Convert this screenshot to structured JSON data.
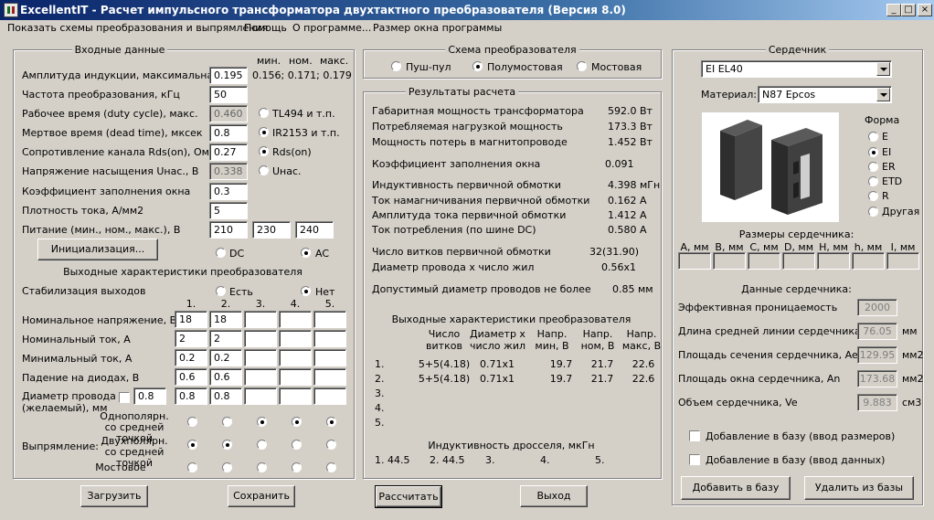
{
  "window": {
    "title": "ExcellentIT - Расчет импульсного трансформатора двухтактного преобразователя (Версия 8.0)",
    "min": "_",
    "max": "□",
    "close": "×"
  },
  "menu": [
    "Показать схемы преобразования и выпрямления",
    "Помощь",
    "О программе...",
    "Размер окна программы"
  ],
  "input": {
    "group_title": "Входные данные",
    "hint_headers": [
      "мин.",
      "ном.",
      "макс."
    ],
    "induction": {
      "label": "Амплитуда индукции, максимальная, Т",
      "value": "0.195",
      "hint": "0.156; 0.171; 0.179"
    },
    "frequency": {
      "label": "Частота преобразования, кГц",
      "value": "50"
    },
    "duty": {
      "label": "Рабочее время (duty cycle), макс.",
      "value": "0.460",
      "option": "TL494 и т.п."
    },
    "dead": {
      "label": "Мертвое время (dead time), мксек",
      "value": "0.8",
      "option": "IR2153 и т.п."
    },
    "rds": {
      "label": "Сопротивление канала Rds(on), Ом",
      "value": "0.27",
      "option": "Rds(on)"
    },
    "usat": {
      "label": "Напряжение насыщения Uнас., В",
      "value": "0.338",
      "option": "Uнас."
    },
    "fill": {
      "label": "Коэффициент заполнения окна",
      "value": "0.3"
    },
    "density": {
      "label": "Плотность тока, А/мм2",
      "value": "5"
    },
    "supply": {
      "label": "Питание (мин., ном., макс.), В",
      "values": [
        "210",
        "230",
        "240"
      ]
    },
    "init_button": "Инициализация...",
    "dc": "DC",
    "ac": "AC"
  },
  "output": {
    "title": "Выходные характеристики преобразователя",
    "stab_label": "Стабилизация выходов",
    "stab_yes": "Есть",
    "stab_no": "Нет",
    "cols": [
      "1.",
      "2.",
      "3.",
      "4.",
      "5."
    ],
    "voltage": {
      "label": "Номинальное напряжение, В",
      "values": [
        "18",
        "18",
        "",
        "",
        ""
      ]
    },
    "current": {
      "label": "Номинальный ток, А",
      "values": [
        "2",
        "2",
        "",
        "",
        ""
      ]
    },
    "min_current": {
      "label": "Минимальный ток, А",
      "values": [
        "0.2",
        "0.2",
        "",
        "",
        ""
      ]
    },
    "diode_drop": {
      "label": "Падение на диодах, В",
      "values": [
        "0.6",
        "0.6",
        "",
        "",
        ""
      ]
    },
    "wire": {
      "label1": "Диаметр провода",
      "label2": "(желаемый), мм",
      "desired": "0.8",
      "values": [
        "0.8",
        "0.8",
        "",
        "",
        ""
      ]
    },
    "rect_label": "Выпрямление:",
    "rect_opts": [
      "Однополярн. со средней точкой",
      "Двухполярн. со средней точкой",
      "Мостовое"
    ]
  },
  "scheme": {
    "title": "Схема преобразователя",
    "options": [
      "Пуш-пул",
      "Полумостовая",
      "Мостовая"
    ]
  },
  "results": {
    "title": "Результаты расчета",
    "rows": [
      {
        "label": "Габаритная мощность трансформатора",
        "value": "592.0 Вт"
      },
      {
        "label": "Потребляемая нагрузкой мощность",
        "value": "173.3 Вт"
      },
      {
        "label": "Мощность потерь в магнитопроводе",
        "value": "1.452 Вт"
      },
      {
        "label": "Коэффициент заполнения окна",
        "value": "0.091"
      },
      {
        "label": "Индуктивность первичной обмотки",
        "value": "4.398 мГн"
      },
      {
        "label": "Ток намагничивания первичной обмотки",
        "value": "0.162 А"
      },
      {
        "label": "Амплитуда тока первичной обмотки",
        "value": "1.412 А"
      },
      {
        "label": "Ток потребления (по шине DC)",
        "value": "0.580 А"
      },
      {
        "label": "Число витков первичной обмотки",
        "value": "32(31.90)"
      },
      {
        "label": "Диаметр провода х число жил",
        "value": "0.56х1"
      },
      {
        "label": "Допустимый диаметр проводов не более",
        "value": "0.85 мм"
      }
    ],
    "out_title": "Выходные характеристики преобразователя",
    "out_headers": [
      [
        "Число",
        "витков"
      ],
      [
        "Диаметр х",
        "число жил"
      ],
      [
        "Напр.",
        "мин, В"
      ],
      [
        "Напр.",
        "ном, В"
      ],
      [
        "Напр.",
        "макс, В"
      ]
    ],
    "out_rows": [
      {
        "n": "1.",
        "turns": "5+5(4.18)",
        "wire": "0.71х1",
        "vmin": "19.7",
        "vnom": "21.7",
        "vmax": "22.6"
      },
      {
        "n": "2.",
        "turns": "5+5(4.18)",
        "wire": "0.71х1",
        "vmin": "19.7",
        "vnom": "21.7",
        "vmax": "22.6"
      },
      {
        "n": "3.",
        "turns": "",
        "wire": "",
        "vmin": "",
        "vnom": "",
        "vmax": ""
      },
      {
        "n": "4.",
        "turns": "",
        "wire": "",
        "vmin": "",
        "vnom": "",
        "vmax": ""
      },
      {
        "n": "5.",
        "turns": "",
        "wire": "",
        "vmin": "",
        "vnom": "",
        "vmax": ""
      }
    ],
    "choke_title": "Индуктивность дросселя, мкГн",
    "choke": [
      "1. 44.5",
      "2. 44.5",
      "3.",
      "4.",
      "5."
    ]
  },
  "core": {
    "title": "Сердечник",
    "selected": "EI EL40",
    "material_label": "Материал:",
    "material": "N87 Epcos",
    "shape_title": "Форма",
    "shapes": [
      "E",
      "EI",
      "ER",
      "ETD",
      "R",
      "Другая"
    ],
    "dims_title": "Размеры сердечника:",
    "dims": [
      "A, мм",
      "B, мм",
      "C, мм",
      "D, мм",
      "H, мм",
      "h, мм",
      "I, мм"
    ],
    "data_title": "Данные сердечника:",
    "data": [
      {
        "label": "Эффективная проницаемость",
        "value": "2000",
        "unit": ""
      },
      {
        "label": "Длина средней линии сердечника, le",
        "value": "76.05",
        "unit": "мм"
      },
      {
        "label": "Площадь сечения сердечника, Ae",
        "value": "129.95",
        "unit": "мм2"
      },
      {
        "label": "Площадь окна сердечника, An",
        "value": "173.68",
        "unit": "мм2"
      },
      {
        "label": "Объем сердечника, Ve",
        "value": "9.883",
        "unit": "см3"
      }
    ],
    "add_dims": "Добавление в базу (ввод размеров)",
    "add_data": "Добавление в базу (ввод данных)",
    "add_btn": "Добавить в базу",
    "del_btn": "Удалить из базы"
  },
  "buttons": {
    "load": "Загрузить",
    "save": "Сохранить",
    "calc": "Рассчитать",
    "exit": "Выход"
  }
}
